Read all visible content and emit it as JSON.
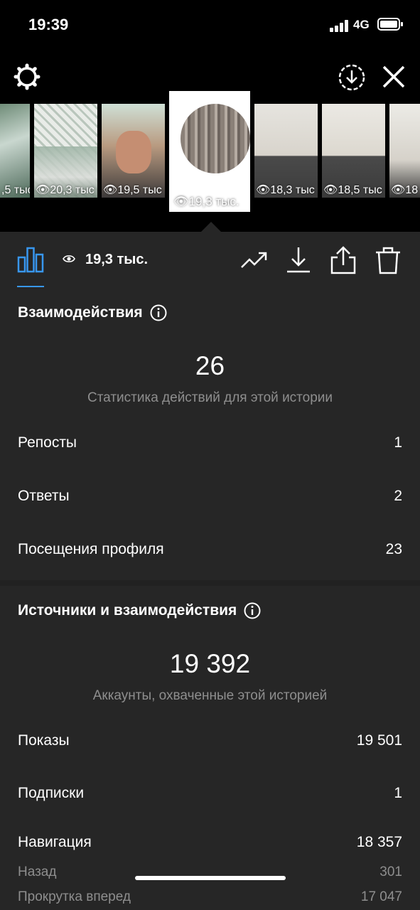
{
  "status": {
    "time": "19:39",
    "network": "4G"
  },
  "icons": {
    "settings": "gear-icon",
    "download_all": "circle-download-icon",
    "close": "close-icon",
    "insights": "bar-chart-icon",
    "trend": "trend-up-icon",
    "save": "download-icon",
    "share": "share-icon",
    "delete": "trash-icon",
    "views": "eye-icon",
    "info": "info-icon"
  },
  "thumbnails": [
    {
      "views": ",5 тыс"
    },
    {
      "views": "20,3 тыс"
    },
    {
      "views": "19,5 тыс"
    },
    {
      "views": "19,3 тыс."
    },
    {
      "views": "18,3 тыс"
    },
    {
      "views": "18,5 тыс"
    },
    {
      "views": "18"
    }
  ],
  "toolbar": {
    "views": "19,3 тыс."
  },
  "interactions": {
    "title": "Взаимодействия",
    "total": "26",
    "caption": "Статистика действий для этой истории",
    "rows": [
      {
        "label": "Репосты",
        "value": "1"
      },
      {
        "label": "Ответы",
        "value": "2"
      },
      {
        "label": "Посещения профиля",
        "value": "23"
      }
    ]
  },
  "discovery": {
    "title": "Источники и взаимодействия",
    "total": "19 392",
    "caption": "Аккаунты, охваченные этой историей",
    "rows": [
      {
        "label": "Показы",
        "value": "19 501"
      },
      {
        "label": "Подписки",
        "value": "1"
      },
      {
        "label": "Навигация",
        "value": "18 357"
      }
    ],
    "sub_rows": [
      {
        "label": "Назад",
        "value": "301"
      },
      {
        "label": "Прокрутка вперед",
        "value": "17 047"
      }
    ]
  },
  "colors": {
    "accent": "#3897f0",
    "panel": "#262626",
    "muted": "#8e8e8e"
  }
}
